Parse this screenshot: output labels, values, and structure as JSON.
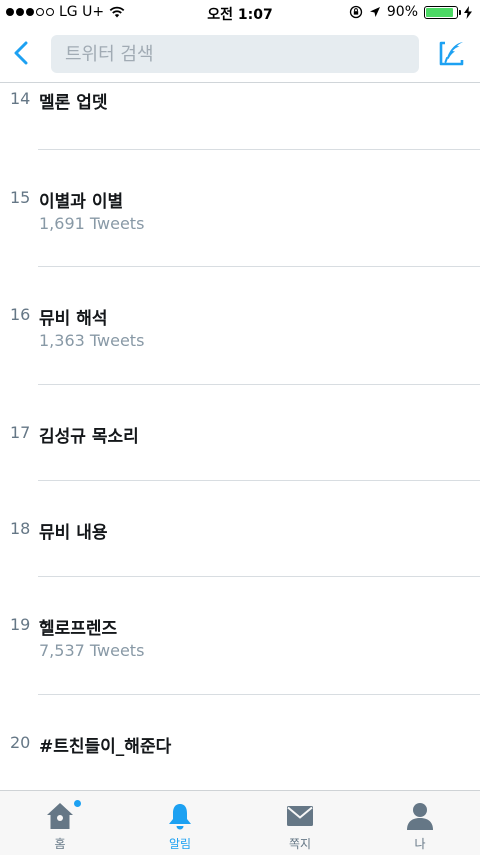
{
  "status_bar": {
    "carrier": "LG U+",
    "time": "오전 1:07",
    "battery": "90%",
    "battery_level": 0.9
  },
  "header": {
    "back_icon": "chevron-left-icon",
    "search_placeholder": "트위터 검색",
    "compose_icon": "compose-quill-icon",
    "accent_color": "#1da1f2"
  },
  "trends": [
    {
      "rank": "14",
      "term": "멜론 업뎃",
      "count": ""
    },
    {
      "rank": "15",
      "term": "이별과 이별",
      "count": "1,691 Tweets"
    },
    {
      "rank": "16",
      "term": "뮤비 해석",
      "count": "1,363 Tweets"
    },
    {
      "rank": "17",
      "term": "김성규 목소리",
      "count": ""
    },
    {
      "rank": "18",
      "term": "뮤비 내용",
      "count": ""
    },
    {
      "rank": "19",
      "term": "헬로프렌즈",
      "count": "7,537 Tweets"
    },
    {
      "rank": "20",
      "term": "#트친들이_해준다",
      "count": ""
    }
  ],
  "tab_bar": {
    "tabs": [
      {
        "label": "홈",
        "icon": "home-icon",
        "active": false,
        "has_dot": true
      },
      {
        "label": "알림",
        "icon": "bell-icon",
        "active": true,
        "has_dot": false
      },
      {
        "label": "쪽지",
        "icon": "envelope-icon",
        "active": false,
        "has_dot": false
      },
      {
        "label": "나",
        "icon": "person-icon",
        "active": false,
        "has_dot": false
      }
    ]
  }
}
